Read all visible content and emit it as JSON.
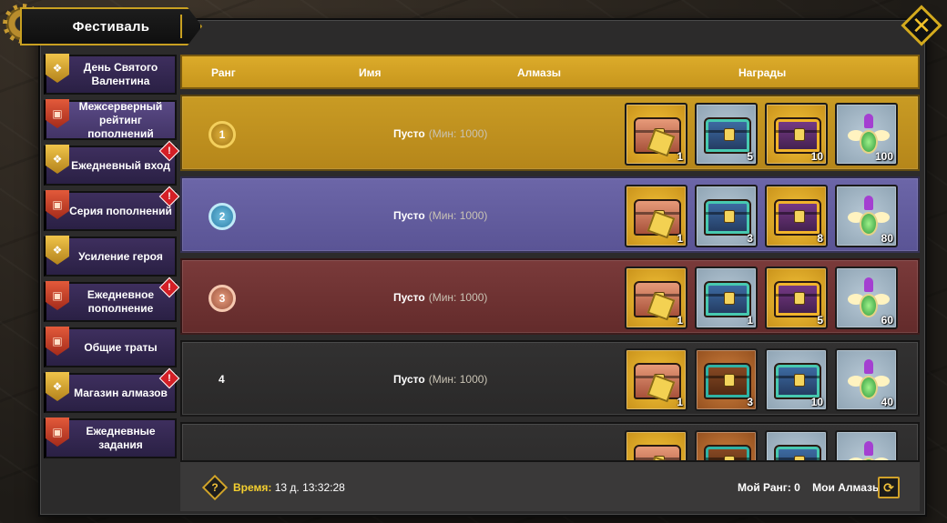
{
  "window": {
    "title": "Фестиваль",
    "close_label": "✕"
  },
  "sidebar": {
    "items": [
      {
        "label": "День Святого Валентина",
        "badge": "gold",
        "alert": false,
        "active": false
      },
      {
        "label": "Межсерверный рейтинг пополнений",
        "badge": "red",
        "alert": false,
        "active": true
      },
      {
        "label": "Ежедневный вход",
        "badge": "gold",
        "alert": true,
        "active": false
      },
      {
        "label": "Серия пополнений",
        "badge": "red",
        "alert": true,
        "active": false
      },
      {
        "label": "Усиление героя",
        "badge": "gold",
        "alert": false,
        "active": false
      },
      {
        "label": "Ежедневное пополнение",
        "badge": "red",
        "alert": true,
        "active": false
      },
      {
        "label": "Общие траты",
        "badge": "red",
        "alert": false,
        "active": false
      },
      {
        "label": "Магазин алмазов",
        "badge": "gold",
        "alert": true,
        "active": false
      },
      {
        "label": "Ежедневные задания",
        "badge": "red",
        "alert": false,
        "active": false
      }
    ]
  },
  "table": {
    "headers": {
      "rank": "Ранг",
      "name": "Имя",
      "diamonds": "Алмазы",
      "rewards": "Награды"
    },
    "rows": [
      {
        "rank": "1",
        "name": "Пусто",
        "min": "(Мин: 1000)",
        "rewards": [
          {
            "icon": "copper-chest-puzzle-icon",
            "qty": "1"
          },
          {
            "icon": "teal-chest-icon",
            "qty": "5"
          },
          {
            "icon": "purple-gold-chest-icon",
            "qty": "10"
          },
          {
            "icon": "winged-potion-icon",
            "qty": "100"
          }
        ]
      },
      {
        "rank": "2",
        "name": "Пусто",
        "min": "(Мин: 1000)",
        "rewards": [
          {
            "icon": "copper-chest-puzzle-icon",
            "qty": "1"
          },
          {
            "icon": "teal-chest-icon",
            "qty": "3"
          },
          {
            "icon": "purple-gold-chest-icon",
            "qty": "8"
          },
          {
            "icon": "winged-potion-icon",
            "qty": "80"
          }
        ]
      },
      {
        "rank": "3",
        "name": "Пусто",
        "min": "(Мин: 1000)",
        "rewards": [
          {
            "icon": "copper-chest-puzzle-icon",
            "qty": "1"
          },
          {
            "icon": "teal-chest-icon",
            "qty": "1"
          },
          {
            "icon": "purple-gold-chest-icon",
            "qty": "5"
          },
          {
            "icon": "winged-potion-icon",
            "qty": "60"
          }
        ]
      },
      {
        "rank": "4",
        "name": "Пусто",
        "min": "(Мин: 1000)",
        "rewards": [
          {
            "icon": "copper-chest-puzzle-icon",
            "qty": "1"
          },
          {
            "icon": "brown-chest-icon",
            "qty": "3"
          },
          {
            "icon": "teal-chest-icon",
            "qty": "10"
          },
          {
            "icon": "winged-potion-icon",
            "qty": "40"
          }
        ]
      }
    ]
  },
  "footer": {
    "help_label": "?",
    "time_label": "Время:",
    "time_value": "13 д. 13:32:28",
    "my_rank": "Мой Ранг: 0",
    "my_diamonds": "Мои Алмазы: 0",
    "refresh_label": "⟳"
  },
  "colors": {
    "accent_gold": "#d4aa1e",
    "rank1": "#c99b24",
    "rank2": "#6c66a8",
    "rank3": "#7a3a3a",
    "sidebar_bg": "#3e2f5e"
  }
}
